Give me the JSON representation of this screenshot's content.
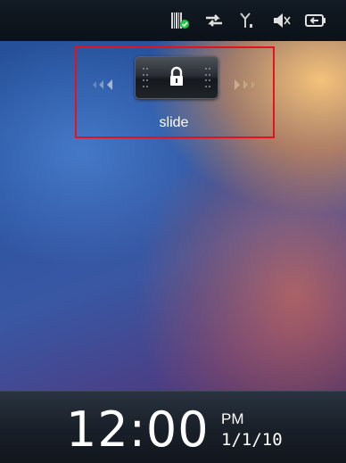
{
  "status_bar": {
    "icons": [
      "barcode-app-icon",
      "data-sync-icon",
      "signal-strength-icon",
      "speaker-muted-icon",
      "battery-charging-icon"
    ]
  },
  "lock_slider": {
    "label": "slide",
    "knob_icon": "lock-icon",
    "left_arrows_icon": "chevrons-left-icon",
    "right_arrows_icon": "chevrons-right-icon"
  },
  "clock": {
    "time": "12:00",
    "ampm": "PM",
    "date": "1/1/10"
  },
  "colors": {
    "highlight": "#e3121e",
    "status_bar": "#0f151c",
    "clock_bar": "#1a2029"
  }
}
